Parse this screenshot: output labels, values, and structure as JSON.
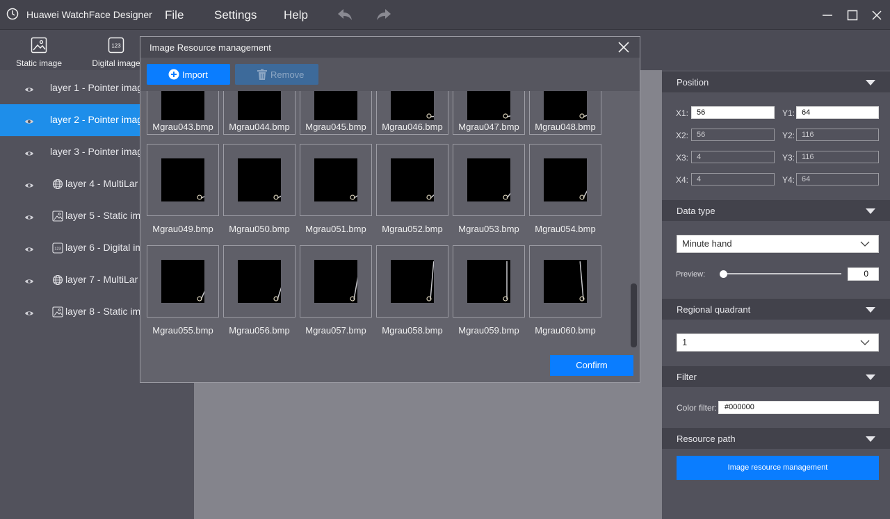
{
  "app": {
    "title": "Huawei WatchFace Designer"
  },
  "menu": {
    "file": "File",
    "settings": "Settings",
    "help": "Help"
  },
  "toolbar": {
    "static_image": "Static image",
    "digital_image": "Digital image"
  },
  "layers": [
    {
      "label": "layer 1 - Pointer imag",
      "icon": "none"
    },
    {
      "label": "layer 2 - Pointer imag",
      "icon": "none",
      "selected": true
    },
    {
      "label": "layer 3 - Pointer imag",
      "icon": "none"
    },
    {
      "label": "layer 4 - MultiLar",
      "icon": "globe-icon"
    },
    {
      "label": "layer 5 - Static im",
      "icon": "image-icon"
    },
    {
      "label": "layer 6 - Digital im",
      "icon": "digit-icon"
    },
    {
      "label": "layer 7 - MultiLar",
      "icon": "globe-icon"
    },
    {
      "label": "layer 8 - Static im",
      "icon": "image-icon"
    }
  ],
  "modal": {
    "title": "Image Resource management",
    "import": "Import",
    "remove": "Remove",
    "confirm": "Confirm",
    "rows": [
      [
        "Mgrau043.bmp",
        "Mgrau044.bmp",
        "Mgrau045.bmp",
        "Mgrau046.bmp",
        "Mgrau047.bmp",
        "Mgrau048.bmp"
      ],
      [
        "Mgrau049.bmp",
        "Mgrau050.bmp",
        "Mgrau051.bmp",
        "Mgrau052.bmp",
        "Mgrau053.bmp",
        "Mgrau054.bmp"
      ],
      [
        "Mgrau055.bmp",
        "Mgrau056.bmp",
        "Mgrau057.bmp",
        "Mgrau058.bmp",
        "Mgrau059.bmp",
        "Mgrau060.bmp"
      ]
    ]
  },
  "props": {
    "position": {
      "title": "Position",
      "x1_label": "X1:",
      "x1": "56",
      "y1_label": "Y1:",
      "y1": "64",
      "x2_label": "X2:",
      "x2": "56",
      "y2_label": "Y2:",
      "y2": "116",
      "x3_label": "X3:",
      "x3": "4",
      "y3_label": "Y3:",
      "y3": "116",
      "x4_label": "X4:",
      "x4": "4",
      "y4_label": "Y4:",
      "y4": "64"
    },
    "data_type": {
      "title": "Data type",
      "value": "Minute hand",
      "preview_label": "Preview:",
      "preview_value": "0"
    },
    "quadrant": {
      "title": "Regional quadrant",
      "value": "1"
    },
    "filter": {
      "title": "Filter",
      "label": "Color filter:",
      "value": "#000000"
    },
    "resource": {
      "title": "Resource path",
      "button": "Image resource management"
    }
  },
  "colors": {
    "accent": "#0a7dff",
    "selected": "#1e8eea"
  }
}
